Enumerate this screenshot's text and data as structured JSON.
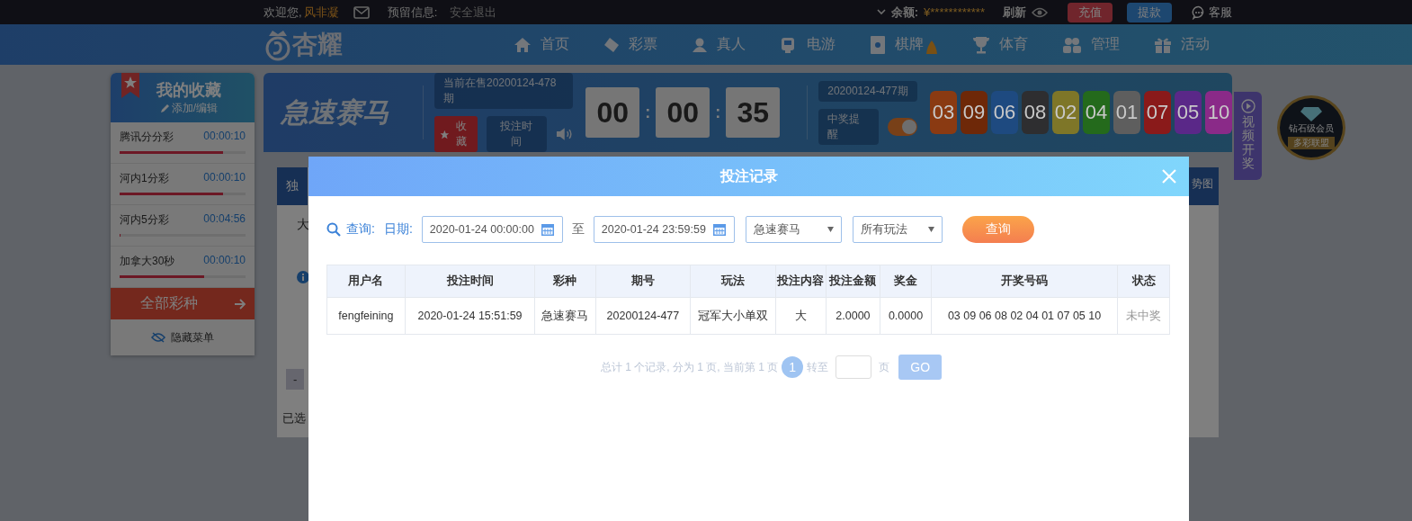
{
  "top_bar": {
    "welcome": "欢迎您,",
    "username": "风非凝",
    "reserved_label": "预留信息:",
    "logout": "安全退出",
    "balance_label": "余额:",
    "balance": "¥************",
    "refresh": "刷新",
    "deposit": "充值",
    "withdraw": "提款",
    "service": "客服"
  },
  "nav": {
    "logo": "杏耀",
    "items": [
      {
        "label": "首页"
      },
      {
        "label": "彩票"
      },
      {
        "label": "真人"
      },
      {
        "label": "电游"
      },
      {
        "label": "棋牌"
      },
      {
        "label": "体育"
      },
      {
        "label": "管理"
      },
      {
        "label": "活动"
      }
    ]
  },
  "favorites": {
    "title": "我的收藏",
    "edit": "添加/编辑",
    "items": [
      {
        "name": "腾讯分分彩",
        "time": "00:00:10",
        "level": 0.82
      },
      {
        "name": "河内1分彩",
        "time": "00:00:10",
        "level": 0.82
      },
      {
        "name": "河内5分彩",
        "time": "00:04:56",
        "level": 0.01
      },
      {
        "name": "加拿大30秒",
        "time": "00:00:10",
        "level": 0.67
      }
    ],
    "all_button": "全部彩种",
    "hide_menu": "隐藏菜单"
  },
  "game": {
    "logo": "急速赛马",
    "current_issue": "当前在售20200124-478期",
    "favorite": "收藏",
    "bet_time": "投注时间",
    "countdown": [
      "00",
      "00",
      "35"
    ],
    "countdown_separator": ":",
    "last_issue": "20200124-477期",
    "win_alert": "中奖提醒",
    "win_alert_on": true,
    "balls": [
      {
        "number": "03",
        "color": "#8a3a12"
      },
      {
        "number": "09",
        "color": "#6e2808"
      },
      {
        "number": "06",
        "color": "#1e4a80"
      },
      {
        "number": "08",
        "color": "#2e2e30"
      },
      {
        "number": "02",
        "color": "#7e7628"
      },
      {
        "number": "04",
        "color": "#246a1c"
      },
      {
        "number": "01",
        "color": "#5e5e5e"
      },
      {
        "number": "07",
        "color": "#8a1a1a"
      },
      {
        "number": "05",
        "color": "#5a2888"
      },
      {
        "number": "10",
        "color": "#8a2a88"
      }
    ]
  },
  "video_tab": "视频开奖",
  "badge": {
    "title": "钻石级会员",
    "ribbon": "多彩联盟"
  },
  "background_panel": {
    "tab": "独",
    "row_1": "大",
    "minus": "-",
    "selected": "已选",
    "trend": "势图"
  },
  "modal": {
    "title": "投注记录",
    "query_label": "查询:",
    "date_label": "日期:",
    "date_from": "2020-01-24 00:00:00",
    "to": "至",
    "date_to": "2020-01-24 23:59:59",
    "lottery": "急速赛马",
    "play": "所有玩法",
    "query_button": "查询",
    "columns": [
      "用户名",
      "投注时间",
      "彩种",
      "期号",
      "玩法",
      "投注内容",
      "投注金额",
      "奖金",
      "开奖号码",
      "状态"
    ],
    "rows": [
      [
        "fengfeining",
        "2020-01-24 15:51:59",
        "急速赛马",
        "20200124-477",
        "冠军大小单双",
        "大",
        "2.0000",
        "0.0000",
        "03 09 06 08 02 04 01 07 05 10",
        "未中奖"
      ]
    ],
    "pagination": {
      "summary": "总计 1 个记录, 分为 1 页, 当前第 1 页",
      "pages": [
        {
          "label": "1",
          "selected": true
        }
      ],
      "goto": "转至",
      "unit": "页",
      "go": "GO"
    }
  }
}
